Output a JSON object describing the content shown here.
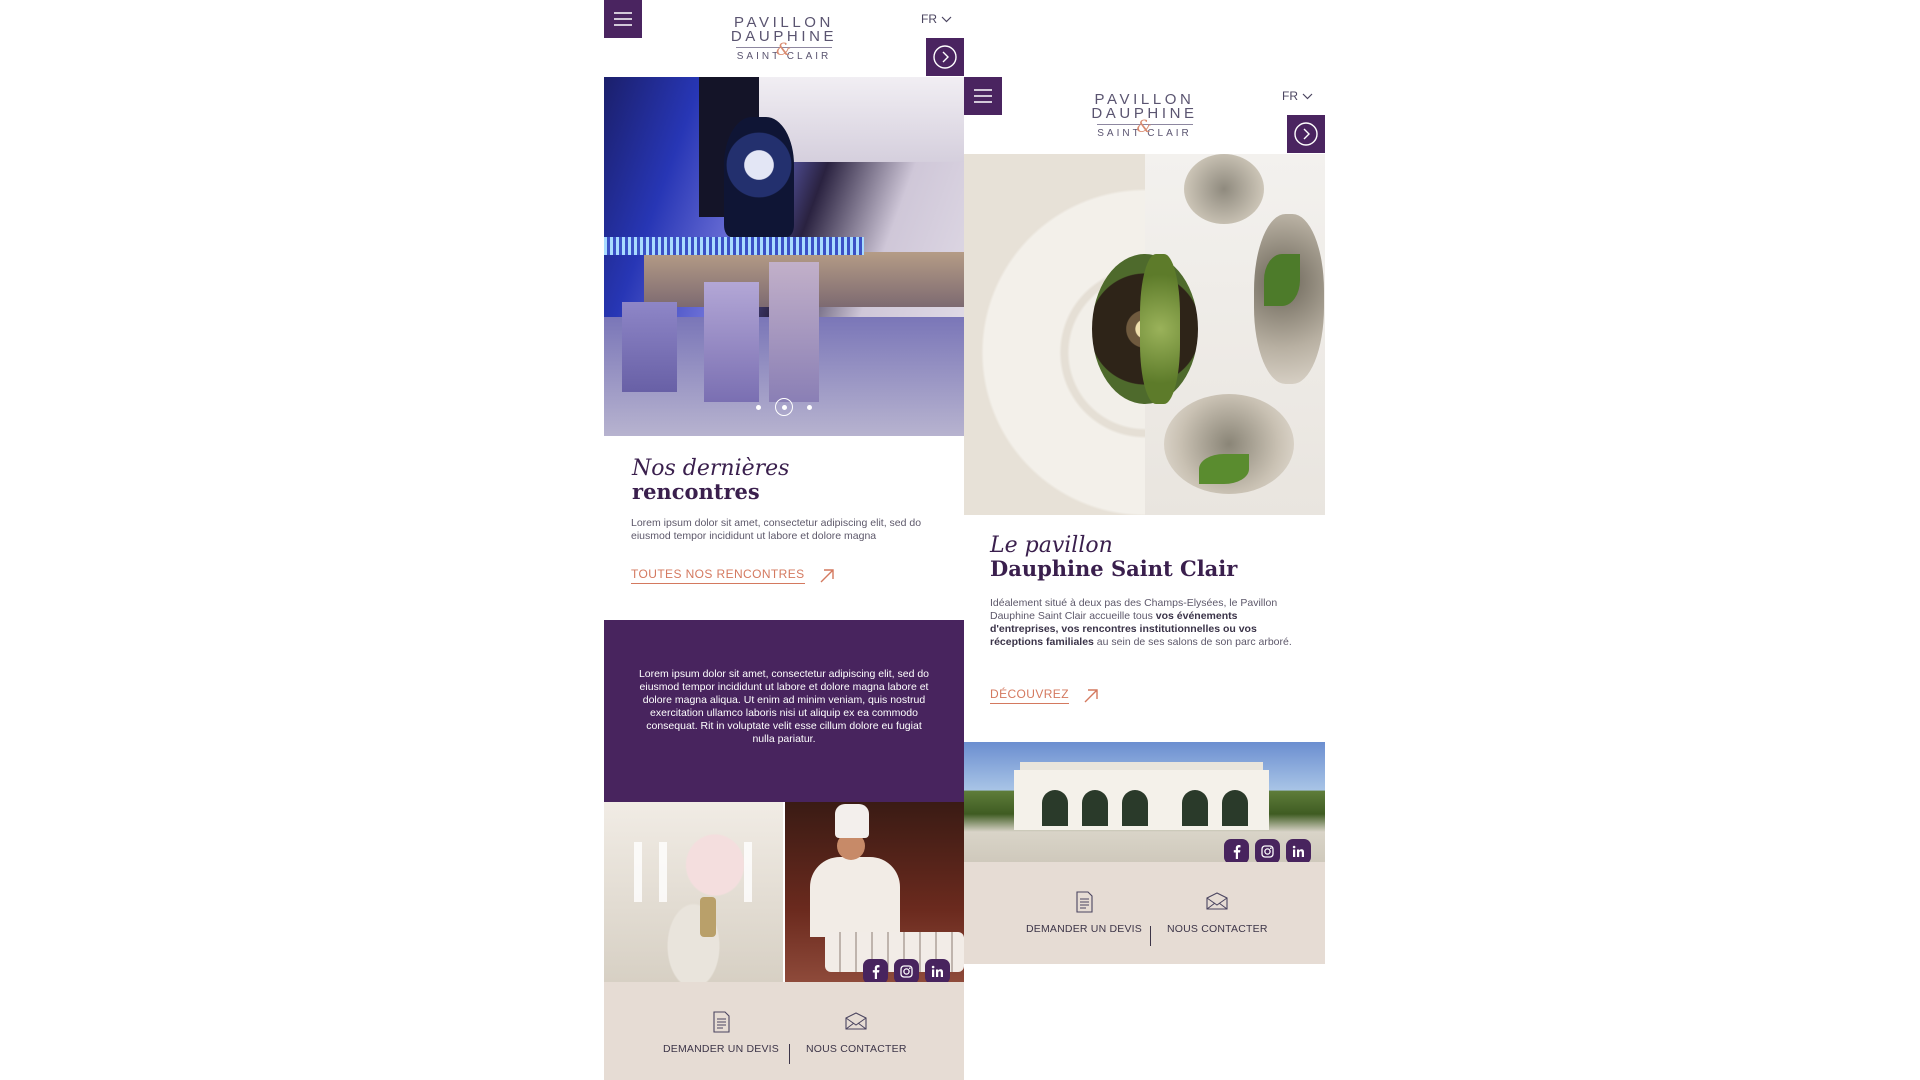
{
  "brand": {
    "line1": "PAVILLON",
    "line2": "DAUPHINE",
    "line3": "SAINT CLAIR",
    "ampersand": "&",
    "colors": {
      "purple": "#48245e",
      "accent": "#d4795f",
      "footer_bg": "#e6dcd4"
    }
  },
  "screen_left": {
    "language": "FR",
    "carousel": {
      "slides": 3,
      "active_slide": 2
    },
    "section": {
      "title_italic": "Nos dernières",
      "title_bold": "rencontres",
      "body": "Lorem ipsum dolor sit amet, consectetur adipiscing elit, sed do eiusmod tempor incididunt ut labore et dolore magna",
      "cta": "TOUTES NOS RENCONTRES"
    },
    "panel_text": "Lorem ipsum dolor sit amet, consectetur adipiscing elit, sed do eiusmod tempor incididunt ut labore et dolore magna labore et dolore magna aliqua. Ut enim ad minim veniam, quis nostrud exercitation ullamco laboris nisi ut aliquip ex ea commodo consequat. Rit in voluptate velit esse cillum dolore eu fugiat nulla pariatur.",
    "footer": {
      "quote_label": "DEMANDER UN DEVIS",
      "contact_label": "NOUS CONTACTER"
    }
  },
  "screen_right": {
    "language": "FR",
    "section": {
      "title_italic": "Le pavillon",
      "title_bold": "Dauphine Saint Clair",
      "body_part1": "Idéalement situé à deux pas des Champs-Elysées, le Pavillon Dauphine Saint Clair accueille tous ",
      "body_bold": "vos événements d'entreprises, vos rencontres institutionnelles ou vos réceptions familiales",
      "body_part2": " au sein de ses salons de son parc arboré.",
      "cta": "DÉCOUVREZ"
    },
    "footer": {
      "quote_label": "DEMANDER UN DEVIS",
      "contact_label": "NOUS CONTACTER"
    }
  },
  "social": [
    "facebook-icon",
    "instagram-icon",
    "linkedin-icon"
  ]
}
